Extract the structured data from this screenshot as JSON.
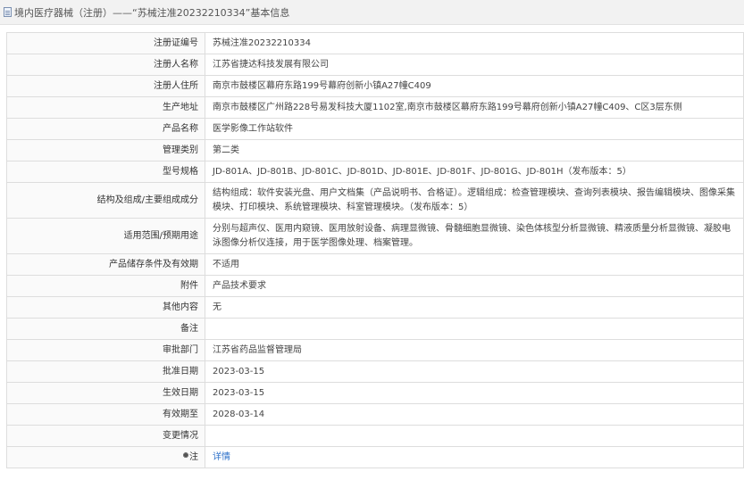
{
  "header": {
    "title": "境内医疗器械（注册）——“苏械注准20232210334”基本信息"
  },
  "rows": [
    {
      "label": "注册证编号",
      "value": "苏械注准20232210334"
    },
    {
      "label": "注册人名称",
      "value": "江苏省捷达科技发展有限公司"
    },
    {
      "label": "注册人住所",
      "value": "南京市鼓楼区幕府东路199号幕府创新小镇A27幢C409"
    },
    {
      "label": "生产地址",
      "value": "南京市鼓楼区广州路228号易发科技大厦1102室,南京市鼓楼区幕府东路199号幕府创新小镇A27幢C409、C区3层东侧"
    },
    {
      "label": "产品名称",
      "value": "医学影像工作站软件"
    },
    {
      "label": "管理类别",
      "value": "第二类"
    },
    {
      "label": "型号规格",
      "value": "JD-801A、JD-801B、JD-801C、JD-801D、JD-801E、JD-801F、JD-801G、JD-801H（发布版本：5）"
    },
    {
      "label": "结构及组成/主要组成成分",
      "value": "结构组成：软件安装光盘、用户文档集（产品说明书、合格证）。逻辑组成：检查管理模块、查询列表模块、报告编辑模块、图像采集模块、打印模块、系统管理模块、科室管理模块。（发布版本：5）"
    },
    {
      "label": "适用范围/预期用途",
      "value": "分别与超声仪、医用内窥镜、医用放射设备、病理显微镜、骨髓细胞显微镜、染色体核型分析显微镜、精液质量分析显微镜、凝胶电泳图像分析仪连接，用于医学图像处理、档案管理。"
    },
    {
      "label": "产品储存条件及有效期",
      "value": "不适用"
    },
    {
      "label": "附件",
      "value": "产品技术要求"
    },
    {
      "label": "其他内容",
      "value": "无"
    },
    {
      "label": "备注",
      "value": ""
    },
    {
      "label": "审批部门",
      "value": "江苏省药品监督管理局"
    },
    {
      "label": "批准日期",
      "value": "2023-03-15"
    },
    {
      "label": "生效日期",
      "value": "2023-03-15"
    },
    {
      "label": "有效期至",
      "value": "2028-03-14"
    },
    {
      "label": "变更情况",
      "value": ""
    }
  ],
  "note_row": {
    "icon": "location-pin-icon",
    "label": "注",
    "link_text": "详情"
  }
}
